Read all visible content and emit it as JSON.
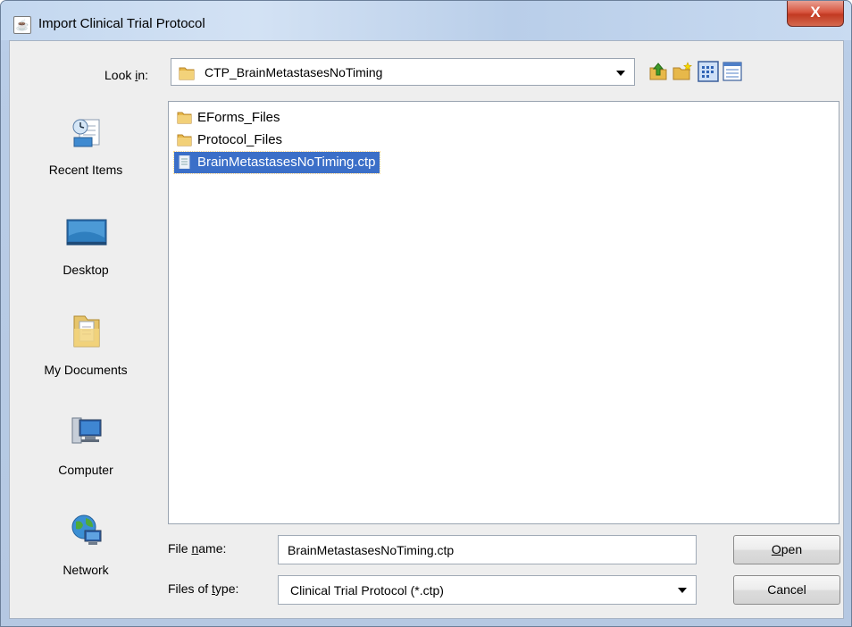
{
  "window": {
    "title": "Import Clinical Trial Protocol",
    "close_symbol": "X"
  },
  "lookin": {
    "label_prefix": "Look ",
    "label_mnemonic": "i",
    "label_suffix": "n:",
    "value": "CTP_BrainMetastasesNoTiming",
    "toolbar_icons": [
      "up-folder-icon",
      "new-folder-icon",
      "list-view-icon",
      "details-view-icon"
    ]
  },
  "places": [
    {
      "label": "Recent Items",
      "icon": "recent-items-icon"
    },
    {
      "label": "Desktop",
      "icon": "desktop-icon"
    },
    {
      "label": "My Documents",
      "icon": "my-documents-icon"
    },
    {
      "label": "Computer",
      "icon": "computer-icon"
    },
    {
      "label": "Network",
      "icon": "network-icon"
    }
  ],
  "files": [
    {
      "name": "EForms_Files",
      "type": "folder",
      "selected": false
    },
    {
      "name": "Protocol_Files",
      "type": "folder",
      "selected": false
    },
    {
      "name": "BrainMetastasesNoTiming.ctp",
      "type": "file",
      "selected": true
    }
  ],
  "filename": {
    "label_prefix": "File ",
    "label_mnemonic": "n",
    "label_suffix": "ame:",
    "value": "BrainMetastasesNoTiming.ctp"
  },
  "filetype": {
    "label_prefix": "Files of ",
    "label_mnemonic": "t",
    "label_suffix": "ype:",
    "value": "Clinical Trial Protocol (*.ctp)"
  },
  "buttons": {
    "open_mnemonic": "O",
    "open_rest": "pen",
    "cancel": "Cancel"
  },
  "colors": {
    "selection": "#3b6fc8",
    "folder": "#e7b84a",
    "close_button": "#c94a32"
  }
}
